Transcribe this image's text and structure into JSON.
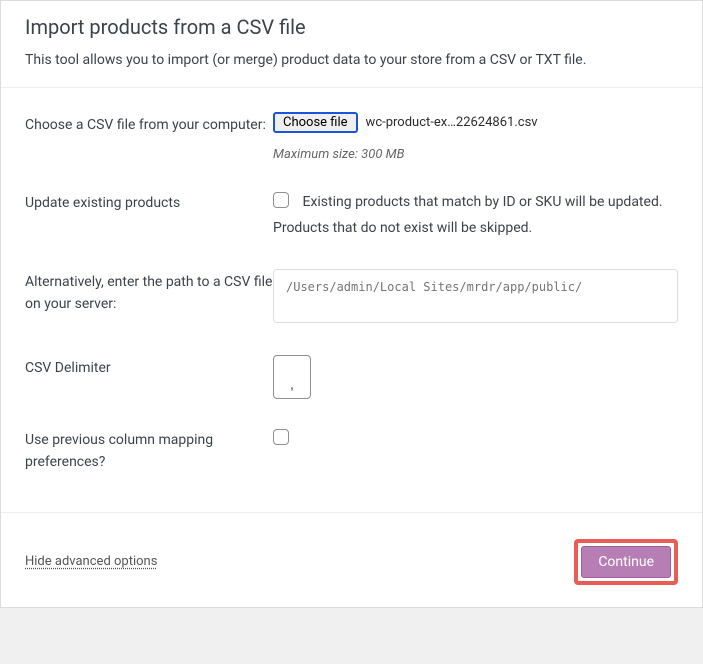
{
  "header": {
    "title": "Import products from a CSV file",
    "subtitle": "This tool allows you to import (or merge) product data to your store from a CSV or TXT file."
  },
  "form": {
    "file": {
      "label": "Choose a CSV file from your computer:",
      "button": "Choose file",
      "filename": "wc-product-ex…22624861.csv",
      "hint": "Maximum size: 300 MB"
    },
    "update": {
      "label": "Update existing products",
      "description": "Existing products that match by ID or SKU will be updated. Products that do not exist will be skipped."
    },
    "path": {
      "label": "Alternatively, enter the path to a CSV file on your server:",
      "placeholder": "/Users/admin/Local Sites/mrdr/app/public/"
    },
    "delimiter": {
      "label": "CSV Delimiter",
      "value": ","
    },
    "mapping": {
      "label": "Use previous column mapping preferences?"
    }
  },
  "footer": {
    "advanced_link": "Hide advanced options",
    "continue": "Continue"
  }
}
